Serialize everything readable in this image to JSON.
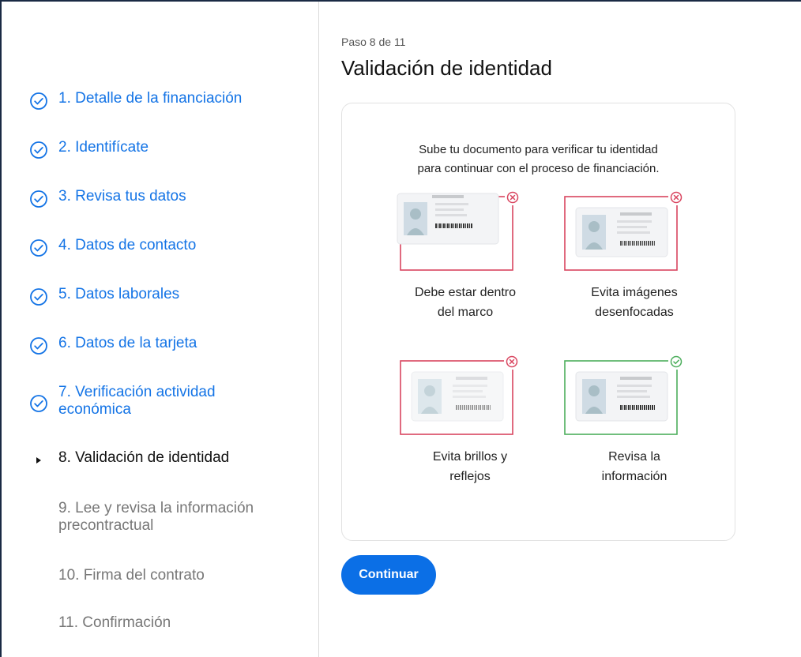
{
  "colors": {
    "accent": "#1474e6",
    "button": "#0b6fe6",
    "error": "#d9455f",
    "success": "#4cae5c"
  },
  "sidebar": {
    "steps": [
      {
        "label": "1. Detalle de la financiación",
        "status": "completed",
        "icon": "check-circle-icon"
      },
      {
        "label": "2. Identifícate",
        "status": "completed",
        "icon": "check-circle-icon"
      },
      {
        "label": "3. Revisa tus datos",
        "status": "completed",
        "icon": "check-circle-icon"
      },
      {
        "label": "4. Datos de contacto",
        "status": "completed",
        "icon": "check-circle-icon"
      },
      {
        "label": "5. Datos laborales",
        "status": "completed",
        "icon": "check-circle-icon"
      },
      {
        "label": "6. Datos de la tarjeta",
        "status": "completed",
        "icon": "check-circle-icon"
      },
      {
        "label_line1": "7. Verificación actividad",
        "label_line2": "económica",
        "status": "completed",
        "icon": "check-circle-icon"
      },
      {
        "label": "8. Validación de identidad",
        "status": "current",
        "icon": "triangle-right-icon"
      },
      {
        "label_line1": "9. Lee y revisa la información",
        "label_line2": "precontractual",
        "status": "pending"
      },
      {
        "label": "10. Firma del contrato",
        "status": "pending"
      },
      {
        "label": "11. Confirmación",
        "status": "pending"
      }
    ]
  },
  "main": {
    "step_counter": "Paso 8 de 11",
    "title": "Validación de identidad",
    "intro_line1": "Sube tu documento para verificar tu identidad",
    "intro_line2": "para continuar con el proceso de financiación.",
    "tips": [
      {
        "line1": "Debe estar dentro",
        "line2": "del marco",
        "status": "error",
        "icon": "x-circle-icon"
      },
      {
        "line1": "Evita imágenes",
        "line2": "desenfocadas",
        "status": "error",
        "icon": "x-circle-icon"
      },
      {
        "line1": "Evita brillos y",
        "line2": "reflejos",
        "status": "error",
        "icon": "x-circle-icon"
      },
      {
        "line1": "Revisa la",
        "line2": "información",
        "status": "ok",
        "icon": "check-circle-icon"
      }
    ],
    "continue_label": "Continuar"
  }
}
